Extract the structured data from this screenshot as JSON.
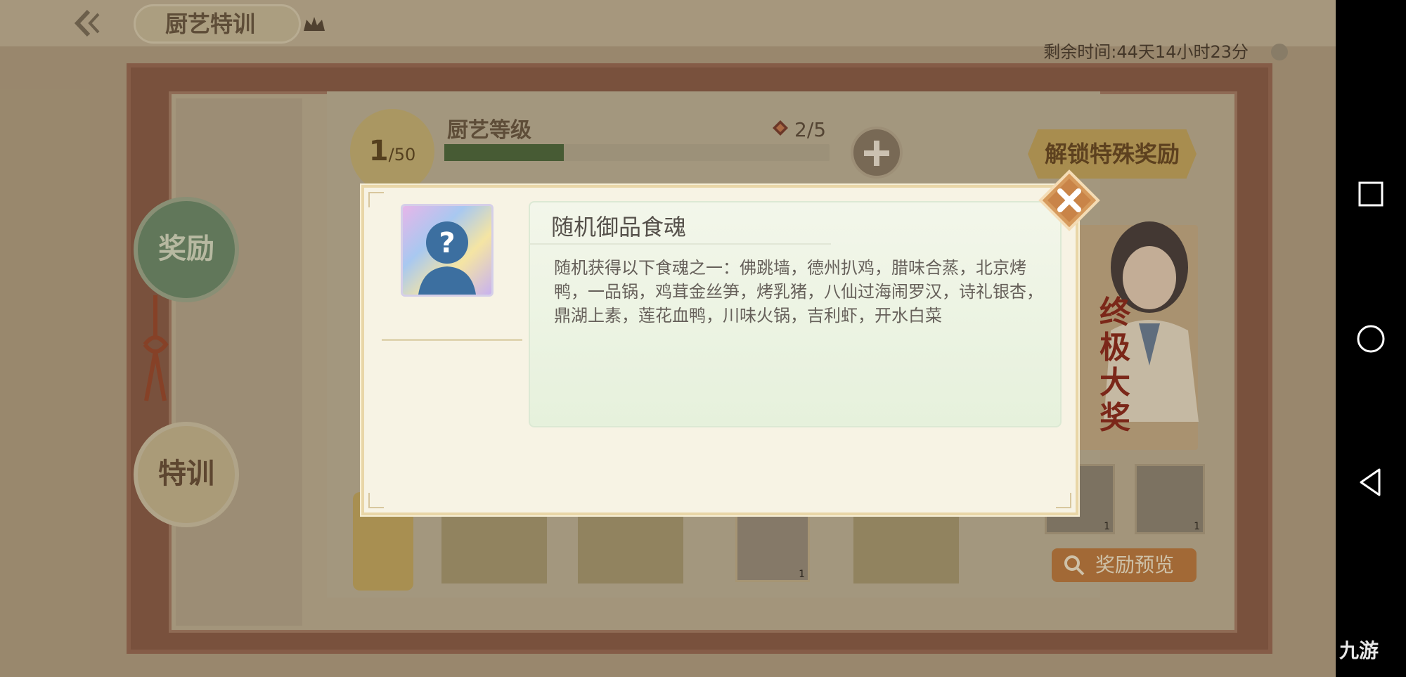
{
  "header": {
    "title": "厨艺特训",
    "remaining_time": "剩余时间:44天14小时23分"
  },
  "sidebar": {
    "reward_label": "奖励",
    "training_label": "特训"
  },
  "level": {
    "current": "1",
    "max": "/50",
    "label": "厨艺等级",
    "progress_fraction": 0.31,
    "gem_count": "2/5"
  },
  "right_panel": {
    "unlock_button": "解锁特殊奖励",
    "grand_prize": "终极大奖",
    "preview_button": "奖励预览",
    "item_quantities": [
      "1",
      "1"
    ]
  },
  "bottom": {
    "card_quantity": "1"
  },
  "modal": {
    "item_name": "随机御品食魂",
    "item_description": "随机获得以下食魂之一：佛跳墙，德州扒鸡，腊味合蒸，北京烤鸭，一品锅，鸡茸金丝笋，烤乳猪，八仙过海闹罗汉，诗礼银杏，鼎湖上素，莲花血鸭，川味火锅，吉利虾，开水白菜",
    "icon": "question-mark-silhouette-icon"
  },
  "system": {
    "watermark": "九游"
  },
  "colors": {
    "modal_bg": "#f7f3e4",
    "panel_bg": "#e6f1dc",
    "close_button": "#d69a5c"
  }
}
